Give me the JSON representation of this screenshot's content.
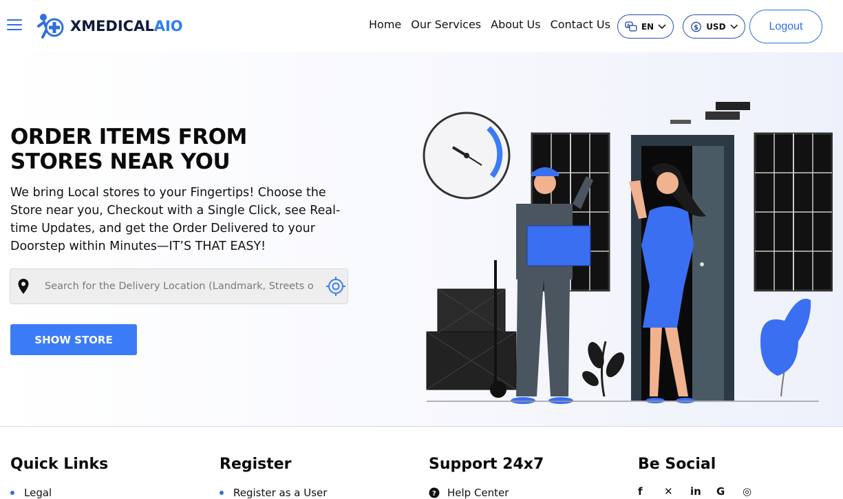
{
  "brand": {
    "name_dark": "XMEDICAL",
    "name_accent": "AIO"
  },
  "nav": {
    "items": [
      "Home",
      "Our Services",
      "About Us",
      "Contact Us"
    ]
  },
  "language": {
    "selected": "EN"
  },
  "currency": {
    "selected": "USD"
  },
  "auth": {
    "logout_label": "Logout"
  },
  "hero": {
    "title_line1": "ORDER ITEMS FROM",
    "title_line2": "STORES NEAR YOU",
    "description": "We bring Local stores to your Fingertips! Choose the Store near you, Checkout with a Single Click, see Real-time Updates, and get the Order Delivered to your Doorstep within Minutes—IT’S THAT EASY!",
    "search_placeholder": "Search for the Delivery Location (Landmark, Streets or Area)",
    "show_store_label": "SHOW STORE"
  },
  "footer": {
    "quick_links": {
      "title": "Quick Links",
      "items": [
        "Legal"
      ]
    },
    "register": {
      "title": "Register",
      "items": [
        "Register as a User"
      ]
    },
    "support": {
      "title": "Support 24x7",
      "items": [
        "Help Center"
      ]
    },
    "social": {
      "title": "Be Social",
      "icons": [
        "facebook-icon",
        "x-icon",
        "linkedin-icon",
        "google-icon",
        "instagram-icon"
      ]
    }
  },
  "colors": {
    "accent": "#3b7cf6",
    "brand_dark": "#0f1b3d",
    "illustration_blue": "#3a6ff2"
  }
}
